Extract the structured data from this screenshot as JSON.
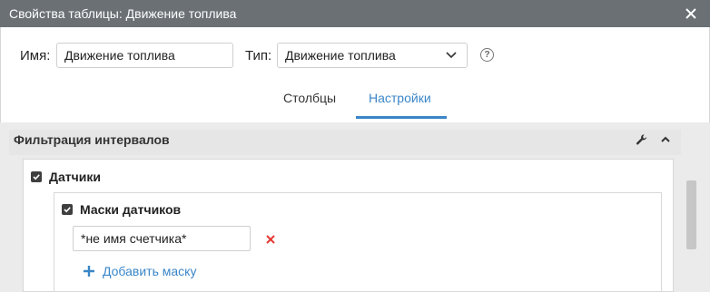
{
  "window": {
    "title": "Свойства таблицы: Движение топлива"
  },
  "form": {
    "name_label": "Имя:",
    "name_value": "Движение топлива",
    "type_label": "Тип:",
    "type_value": "Движение топлива",
    "help_glyph": "?"
  },
  "tabs": [
    {
      "label": "Столбцы",
      "active": false
    },
    {
      "label": "Настройки",
      "active": true
    }
  ],
  "section": {
    "title": "Фильтрация интервалов",
    "sensors": {
      "label": "Датчики",
      "checked": true,
      "masks": {
        "label": "Маски датчиков",
        "checked": true,
        "items": [
          "*не имя счетчика*"
        ],
        "add_label": "Добавить маску"
      }
    }
  },
  "colors": {
    "accent": "#3a86c8",
    "titlebar": "#6b7075",
    "delete": "#e53935"
  },
  "icons": {
    "close": "close-icon",
    "chevron": "chevron-down-icon",
    "help": "help-icon",
    "wrench": "wrench-icon",
    "collapse": "chevron-up-icon",
    "delete": "delete-x-icon",
    "add": "plus-icon"
  }
}
